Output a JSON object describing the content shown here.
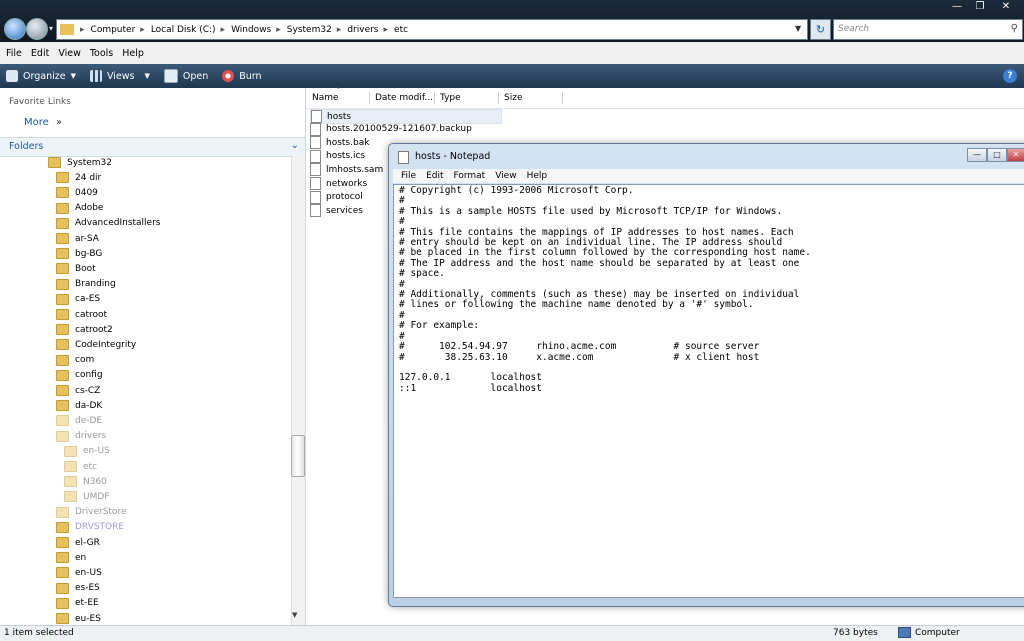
{
  "explorer": {
    "address_crumbs": [
      "Computer",
      "Local Disk (C:)",
      "Windows",
      "System32",
      "drivers",
      "etc"
    ],
    "search_placeholder": "Search",
    "menu": [
      "File",
      "Edit",
      "View",
      "Tools",
      "Help"
    ],
    "toolbar": {
      "organize": "Organize",
      "views": "Views",
      "open": "Open",
      "burn": "Burn"
    },
    "favorite_links_label": "Favorite Links",
    "more_label": "More",
    "folders_label": "Folders",
    "tree": [
      {
        "label": "System32",
        "indent": 0,
        "style": "normal"
      },
      {
        "label": "24 dir",
        "indent": 1,
        "style": "normal"
      },
      {
        "label": "0409",
        "indent": 1,
        "style": "normal"
      },
      {
        "label": "Adobe",
        "indent": 1,
        "style": "normal"
      },
      {
        "label": "AdvancedInstallers",
        "indent": 1,
        "style": "normal"
      },
      {
        "label": "ar-SA",
        "indent": 1,
        "style": "normal"
      },
      {
        "label": "bg-BG",
        "indent": 1,
        "style": "normal"
      },
      {
        "label": "Boot",
        "indent": 1,
        "style": "normal"
      },
      {
        "label": "Branding",
        "indent": 1,
        "style": "normal"
      },
      {
        "label": "ca-ES",
        "indent": 1,
        "style": "normal"
      },
      {
        "label": "catroot",
        "indent": 1,
        "style": "normal"
      },
      {
        "label": "catroot2",
        "indent": 1,
        "style": "normal"
      },
      {
        "label": "CodeIntegrity",
        "indent": 1,
        "style": "normal"
      },
      {
        "label": "com",
        "indent": 1,
        "style": "normal"
      },
      {
        "label": "config",
        "indent": 1,
        "style": "normal"
      },
      {
        "label": "cs-CZ",
        "indent": 1,
        "style": "normal"
      },
      {
        "label": "da-DK",
        "indent": 1,
        "style": "normal"
      },
      {
        "label": "de-DE",
        "indent": 1,
        "style": "dim"
      },
      {
        "label": "drivers",
        "indent": 1,
        "style": "dim"
      },
      {
        "label": "en-US",
        "indent": 2,
        "style": "dim"
      },
      {
        "label": "etc",
        "indent": 2,
        "style": "dim"
      },
      {
        "label": "N360",
        "indent": 2,
        "style": "dim"
      },
      {
        "label": "UMDF",
        "indent": 2,
        "style": "dim"
      },
      {
        "label": "DriverStore",
        "indent": 1,
        "style": "dim"
      },
      {
        "label": "DRVSTORE",
        "indent": 1,
        "style": "purple"
      },
      {
        "label": "el-GR",
        "indent": 1,
        "style": "normal"
      },
      {
        "label": "en",
        "indent": 1,
        "style": "normal"
      },
      {
        "label": "en-US",
        "indent": 1,
        "style": "normal"
      },
      {
        "label": "es-ES",
        "indent": 1,
        "style": "normal"
      },
      {
        "label": "et-EE",
        "indent": 1,
        "style": "normal"
      },
      {
        "label": "eu-ES",
        "indent": 1,
        "style": "normal"
      }
    ],
    "columns": [
      "Name",
      "Date modif...",
      "Type",
      "Size"
    ],
    "files": [
      "hosts",
      "hosts.20100529-121607.backup",
      "hosts.bak",
      "hosts.ics",
      "lmhosts.sam",
      "networks",
      "protocol",
      "services"
    ],
    "status": {
      "selection": "1 item selected",
      "size": "763 bytes",
      "location": "Computer"
    }
  },
  "notepad": {
    "title": "hosts - Notepad",
    "menu": [
      "File",
      "Edit",
      "Format",
      "View",
      "Help"
    ],
    "content": "# Copyright (c) 1993-2006 Microsoft Corp.\n#\n# This is a sample HOSTS file used by Microsoft TCP/IP for Windows.\n#\n# This file contains the mappings of IP addresses to host names. Each\n# entry should be kept on an individual line. The IP address should\n# be placed in the first column followed by the corresponding host name.\n# The IP address and the host name should be separated by at least one\n# space.\n#\n# Additionally, comments (such as these) may be inserted on individual\n# lines or following the machine name denoted by a '#' symbol.\n#\n# For example:\n#\n#      102.54.94.97     rhino.acme.com          # source server\n#       38.25.63.10     x.acme.com              # x client host\n\n127.0.0.1       localhost\n::1             localhost"
  }
}
